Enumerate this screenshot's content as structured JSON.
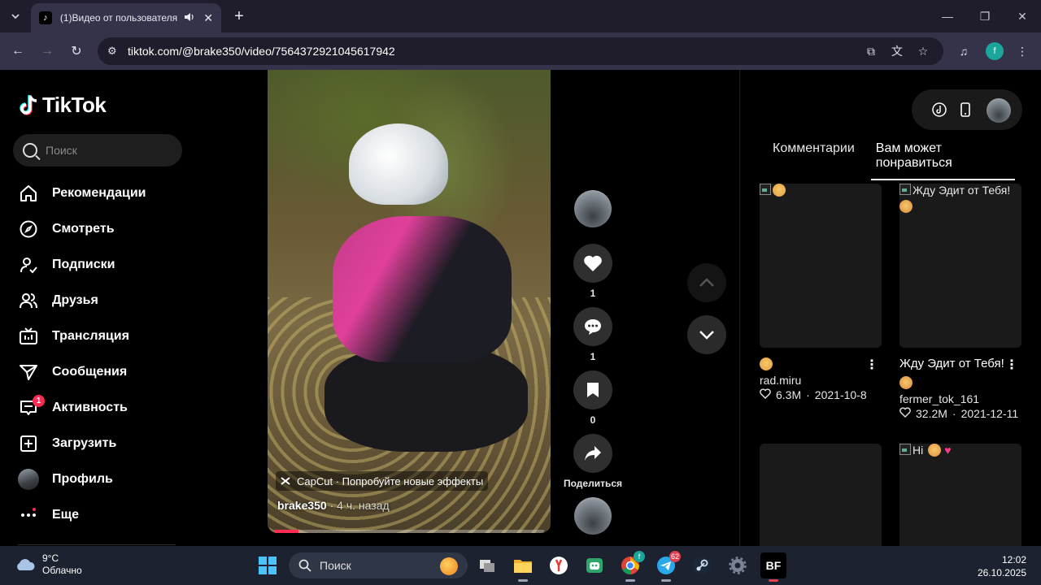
{
  "browser": {
    "tab_title": "(1)Видео от пользователя",
    "url": "tiktok.com/@brake350/video/7564372921045617942",
    "profile_initial": "f"
  },
  "tiktok": {
    "logo_text": "TikTok",
    "search_placeholder": "Поиск",
    "nav": [
      {
        "label": "Рекомендации",
        "icon": "home-icon"
      },
      {
        "label": "Смотреть",
        "icon": "compass-icon"
      },
      {
        "label": "Подписки",
        "icon": "following-icon"
      },
      {
        "label": "Друзья",
        "icon": "friends-icon"
      },
      {
        "label": "Трансляция",
        "icon": "live-icon"
      },
      {
        "label": "Сообщения",
        "icon": "send-icon"
      },
      {
        "label": "Активность",
        "icon": "activity-icon",
        "badge": "1"
      },
      {
        "label": "Загрузить",
        "icon": "upload-icon"
      },
      {
        "label": "Профиль",
        "icon": "avatar"
      },
      {
        "label": "Еще",
        "icon": "more-icon"
      }
    ],
    "video": {
      "capcut_text": "CapCut · Попробуйте новые эффекты",
      "author": "brake350",
      "time": " · 4 ч. назад",
      "progress_percent": 9
    },
    "actions": {
      "likes": "1",
      "comments": "1",
      "saves": "0",
      "share_label": "Поделиться"
    },
    "right_panel": {
      "tab_comments": "Комментарии",
      "tab_recommended": "Вам может понравиться",
      "cards": [
        {
          "thumb_alt": "",
          "thumb_emoji": "smile",
          "desc": "",
          "desc_emoji": "smile",
          "author": "rad.miru",
          "likes": "6.3M",
          "date": "2021-10-8"
        },
        {
          "thumb_alt": "Жду Эдит от Тебя!",
          "thumb_emoji": "blush",
          "desc": "Жду Эдит от Тебя!",
          "desc_emoji": "blush",
          "author": "fermer_tok_161",
          "likes": "32.2M",
          "date": "2021-12-11"
        },
        {
          "thumb_alt": "",
          "thumb_emoji": "",
          "desc": "",
          "desc_emoji": "",
          "author": "",
          "likes": "",
          "date": ""
        },
        {
          "thumb_alt": "Hi",
          "thumb_emoji": "heart-eyes",
          "desc": "",
          "desc_emoji": "",
          "author": "",
          "likes": "",
          "date": ""
        }
      ]
    }
  },
  "taskbar": {
    "weather_temp": "9°C",
    "weather_desc": "Облачно",
    "search_label": "Поиск",
    "time": "12:02",
    "date": "26.10.2025",
    "telegram_badge": "62"
  }
}
